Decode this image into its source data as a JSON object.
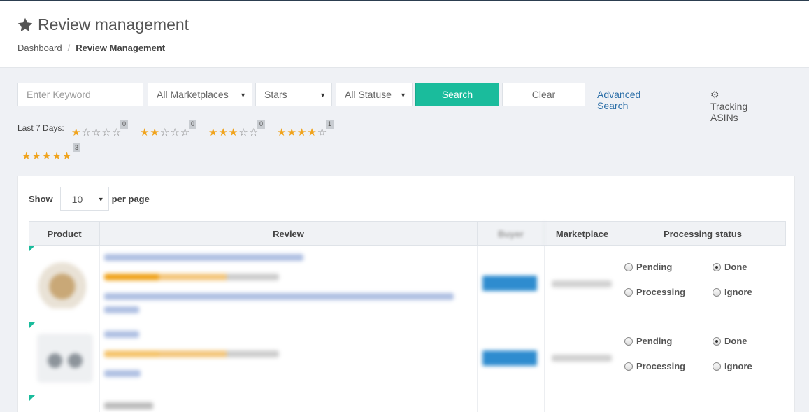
{
  "header": {
    "title": "Review management",
    "breadcrumb": {
      "home": "Dashboard",
      "separator": "/",
      "current": "Review Management"
    }
  },
  "filters": {
    "keyword_placeholder": "Enter Keyword",
    "marketplace": "All Marketplaces",
    "stars": "Stars",
    "status": "All Statuse",
    "search_label": "Search",
    "clear_label": "Clear",
    "advanced_label": "Advanced Search",
    "tracking_label": "Tracking ASINs"
  },
  "last7": {
    "label": "Last 7 Days:",
    "groups": [
      {
        "rating": 1,
        "count": "0"
      },
      {
        "rating": 2,
        "count": "0"
      },
      {
        "rating": 3,
        "count": "0"
      },
      {
        "rating": 4,
        "count": "1"
      },
      {
        "rating": 5,
        "count": "3"
      }
    ]
  },
  "pager": {
    "show_label": "Show",
    "per_page_value": "10",
    "per_page_label": "per page"
  },
  "table": {
    "columns": [
      "Product",
      "Review",
      "Buyer",
      "Marketplace",
      "Processing status"
    ],
    "status_options": {
      "pending": "Pending",
      "done": "Done",
      "processing": "Processing",
      "ignore": "Ignore"
    },
    "rows": [
      {
        "selected_status": "done"
      },
      {
        "selected_status": "done"
      }
    ]
  },
  "colors": {
    "accent": "#1abc9c",
    "link": "#2b6ea7",
    "star": "#f0a31c"
  }
}
